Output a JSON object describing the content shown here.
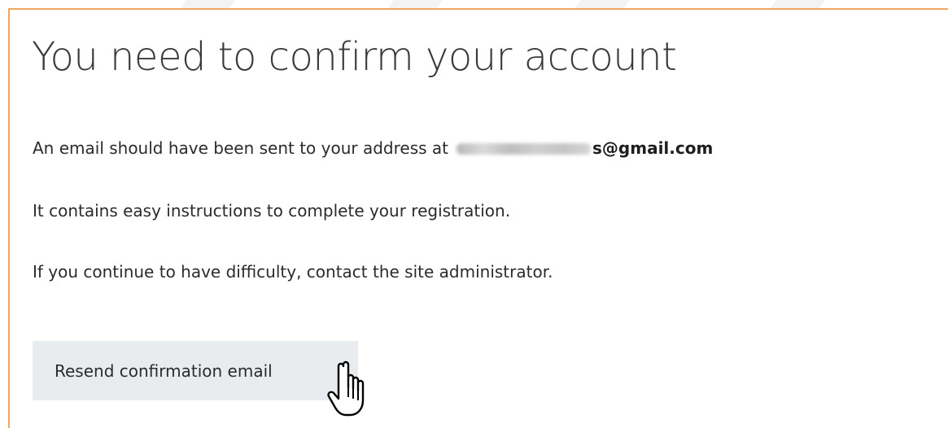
{
  "page": {
    "title": "You need to confirm your account",
    "email_line_prefix": "An email should have been sent to your address at",
    "email_visible_suffix": "s@gmail.com",
    "instructions_line": "It contains easy instructions to complete your registration.",
    "help_line": "If you continue to have difficulty, contact the site administrator."
  },
  "actions": {
    "resend_label": "Resend confirmation email"
  },
  "cursor": {
    "icon": "hand-pointer-icon"
  },
  "colors": {
    "panel_border": "#f0a560",
    "button_bg": "#e9ecef",
    "text": "#2b2b2b"
  }
}
